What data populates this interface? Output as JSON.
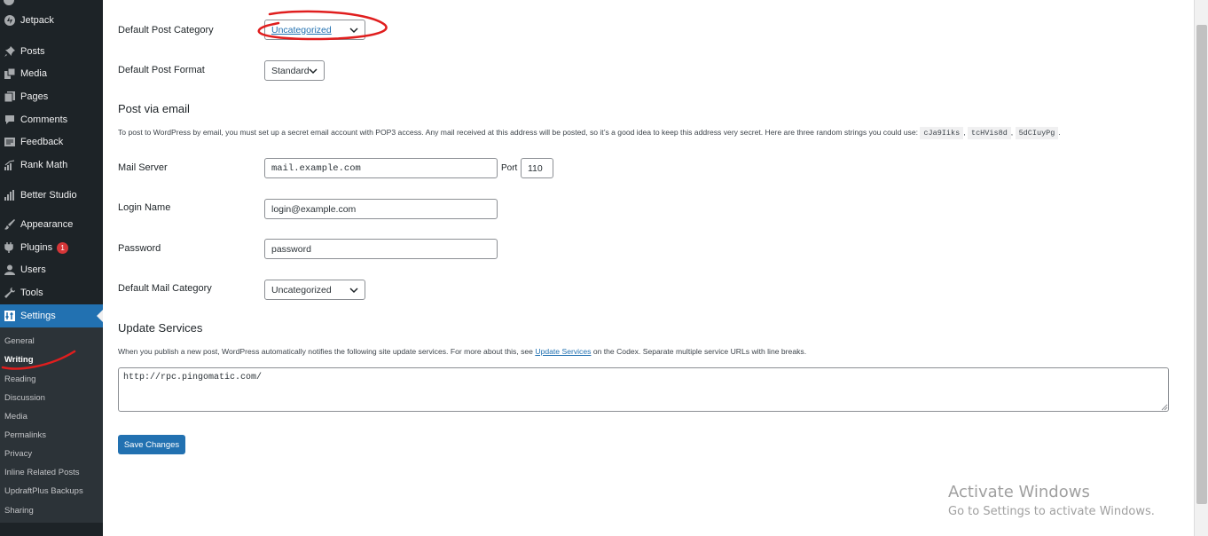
{
  "sidebar": {
    "items": [
      {
        "label": "Jetpack",
        "icon": "jetpack-icon"
      },
      {
        "label": "Posts",
        "icon": "pin-icon"
      },
      {
        "label": "Media",
        "icon": "media-icon"
      },
      {
        "label": "Pages",
        "icon": "pages-icon"
      },
      {
        "label": "Comments",
        "icon": "comment-icon"
      },
      {
        "label": "Feedback",
        "icon": "feedback-icon"
      },
      {
        "label": "Rank Math",
        "icon": "chart-icon"
      },
      {
        "label": "Better Studio",
        "icon": "bars-icon"
      },
      {
        "label": "Appearance",
        "icon": "brush-icon"
      },
      {
        "label": "Plugins",
        "icon": "plugin-icon",
        "badge": "1"
      },
      {
        "label": "Users",
        "icon": "user-icon"
      },
      {
        "label": "Tools",
        "icon": "wrench-icon"
      },
      {
        "label": "Settings",
        "icon": "settings-icon",
        "current": true
      }
    ],
    "submenu": [
      "General",
      "Writing",
      "Reading",
      "Discussion",
      "Media",
      "Permalinks",
      "Privacy",
      "Inline Related Posts",
      "UpdraftPlus Backups",
      "Sharing"
    ],
    "submenu_current": "Writing"
  },
  "form": {
    "default_post_category": {
      "label": "Default Post Category",
      "value": "Uncategorized"
    },
    "default_post_format": {
      "label": "Default Post Format",
      "value": "Standard"
    },
    "post_via_email": {
      "title": "Post via email",
      "description": "To post to WordPress by email, you must set up a secret email account with POP3 access. Any mail received at this address will be posted, so it’s a good idea to keep this address very secret. Here are three random strings you could use:",
      "codes": [
        "cJa9Iiks",
        "tcHVis8d",
        "5dCIuyPg"
      ]
    },
    "mail_server": {
      "label": "Mail Server",
      "value": "mail.example.com",
      "port_label": "Port",
      "port_value": "110"
    },
    "login_name": {
      "label": "Login Name",
      "value": "login@example.com"
    },
    "password": {
      "label": "Password",
      "value": "password"
    },
    "default_mail_category": {
      "label": "Default Mail Category",
      "value": "Uncategorized"
    },
    "update_services": {
      "title": "Update Services",
      "description_pre": "When you publish a new post, WordPress automatically notifies the following site update services. For more about this, see",
      "link": "Update Services",
      "description_post": "on the Codex. Separate multiple service URLs with line breaks.",
      "value": "http://rpc.pingomatic.com/"
    },
    "save_label": "Save Changes"
  },
  "watermark": {
    "line1": "Activate Windows",
    "line2": "Go to Settings to activate Windows."
  },
  "colors": {
    "sidebar_bg": "#1d2327",
    "accent": "#2271b1",
    "annotation": "#e01e1e"
  }
}
